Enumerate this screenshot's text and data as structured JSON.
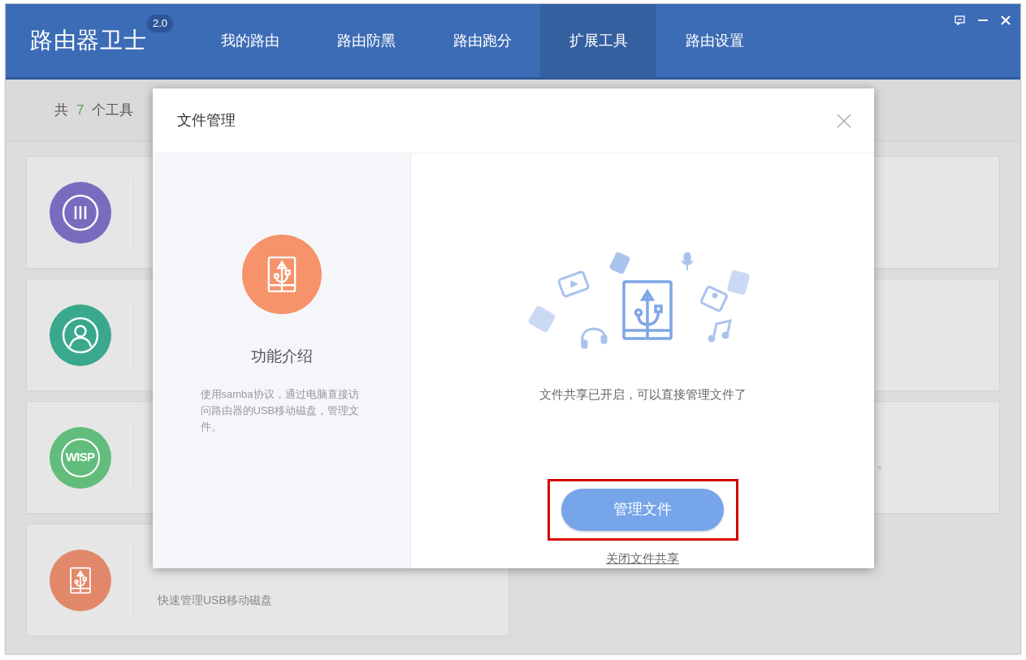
{
  "app": {
    "name": "路由器卫士",
    "version": "2.0"
  },
  "tabs": [
    {
      "label": "我的路由",
      "selected": false
    },
    {
      "label": "路由防黑",
      "selected": false
    },
    {
      "label": "路由跑分",
      "selected": false
    },
    {
      "label": "扩展工具",
      "selected": true
    },
    {
      "label": "路由设置",
      "selected": false
    }
  ],
  "toolbar": {
    "prefix": "共",
    "count": "7",
    "suffix": "个工具"
  },
  "cards_left": [
    {
      "kind": "bars",
      "color": "#7b6bbf"
    },
    {
      "kind": "person",
      "color": "#3aa88c"
    },
    {
      "kind": "text",
      "icon_text": "WISP",
      "color": "#62bd7c"
    },
    {
      "kind": "usb",
      "color": "#e2886a",
      "description": "快速管理USB移动磁盘"
    }
  ],
  "cards_right": [
    {
      "kind": "covered"
    },
    {
      "kind": "covered"
    },
    {
      "kind": "covered",
      "description": "。"
    }
  ],
  "dialog": {
    "title": "文件管理",
    "intro_heading": "功能介绍",
    "intro_text": "使用samba协议，通过电脑直接访问路由器的USB移动磁盘，管理文件。",
    "status": "文件共享已开启，可以直接管理文件了",
    "primary_button": {
      "label": "管理文件",
      "highlighted": true
    },
    "link": "关闭文件共享"
  }
}
